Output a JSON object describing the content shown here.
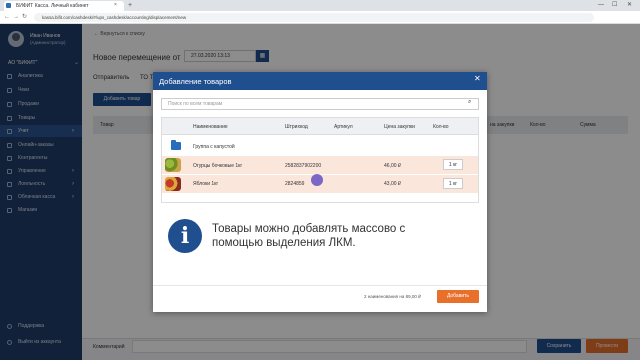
{
  "browser": {
    "tab_title": "БИФИТ Касса. Личный кабинет",
    "tab_close": "×",
    "new_tab": "+",
    "url": "kassa.bifit.com/cashdesk/#/ups_cashdesk/accounting/displacement/new",
    "controls": {
      "minimize": "—",
      "maximize": "☐",
      "close": "✕"
    },
    "nav": {
      "back": "←",
      "forward": "→",
      "reload": "↻"
    }
  },
  "user": {
    "name": "Иван Иванов",
    "role": "(Администратор)"
  },
  "org": {
    "name": "АО \"БИФИТ\"",
    "chevron": "⌄"
  },
  "sidebar": {
    "items": [
      {
        "label": "Аналитика"
      },
      {
        "label": "Чеки"
      },
      {
        "label": "Продажи"
      },
      {
        "label": "Товары"
      },
      {
        "label": "Учет",
        "chev": "›"
      },
      {
        "label": "Онлайн-заказы"
      },
      {
        "label": "Контрагенты"
      },
      {
        "label": "Управление",
        "chev": "›"
      },
      {
        "label": "Лояльность",
        "chev": "›"
      },
      {
        "label": "Облачная касса",
        "chev": "›"
      },
      {
        "label": "Магазин"
      }
    ],
    "bottom": [
      {
        "label": "Поддержка"
      },
      {
        "label": "Выйти из аккаунта"
      }
    ]
  },
  "page": {
    "back_link": "←   Вернуться к списку",
    "title": "Новое перемещение от",
    "date_value": "27.03.2020 13:13",
    "calendar_icon": "▦",
    "sender_label": "Отправитель",
    "sender_value": "ТО Т",
    "add_button": "Добавить товар",
    "table_headers": [
      "Товар",
      "на закупки",
      "Кол-во",
      "Сумма"
    ],
    "comment_label": "Комментарий",
    "save_button": "Сохранить",
    "accept_button": "Провести"
  },
  "modal": {
    "title": "Добавление товаров",
    "close": "✕",
    "search_placeholder": "Поиск по всем товарам",
    "search_icon": "⌕",
    "headers": [
      "Наименование",
      "Штрихкод",
      "Артикул",
      "Цена закупки",
      "Кол-во"
    ],
    "group_name": "Группа с капустой",
    "products": [
      {
        "name": "Огурцы бочковые 1кг",
        "barcode": "2582837902200",
        "article": "",
        "price": "46,00 ₽",
        "qty": "1 кг"
      },
      {
        "name": "Яблоки 1кг",
        "barcode": "2824859",
        "article": "",
        "price": "43,00 ₽",
        "qty": "1 кг"
      }
    ],
    "info_icon": "i",
    "info_text": "Товары можно добавлять массово с помощью выделения ЛКМ.",
    "count_text": "2 наименования на 89,00 ₽",
    "add_button": "Добавить"
  },
  "colors": {
    "sidebar": "#1f3d6b",
    "primary": "#1f4f8f",
    "accent": "#e8702a",
    "row_highlight": "#fbe6dc"
  }
}
